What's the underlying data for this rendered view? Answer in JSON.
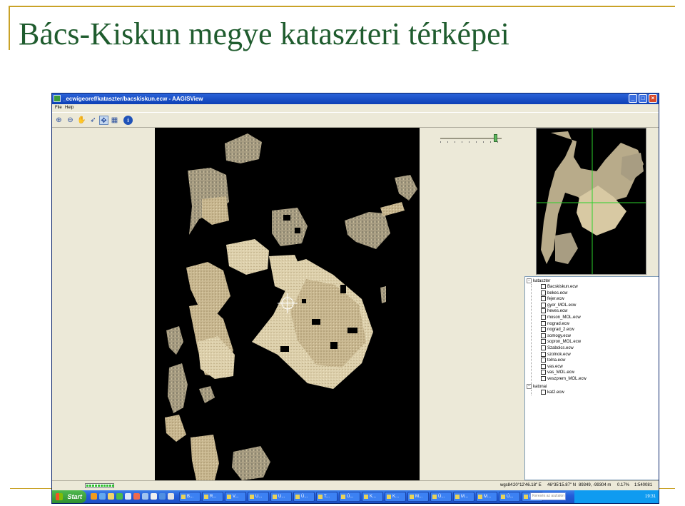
{
  "slide": {
    "title": "Bács-Kiskun megye kataszteri térképei"
  },
  "window": {
    "title": "_ecwigeoref/kataszter/bacskiskun.ecw - AAGISView",
    "menu": [
      "File",
      "Help"
    ],
    "toolbar": {
      "tools": [
        "zoom-in",
        "zoom-out",
        "pan",
        "select",
        "zoom-extent",
        "layers",
        "info"
      ],
      "active_tool": "zoom-extent"
    },
    "zoom_level_fraction": 0.92
  },
  "tree": {
    "groups": [
      {
        "name": "kataszter",
        "items": [
          "Bacskiskun.ecw",
          "bekes.ecw",
          "fejer.ecw",
          "gyor_MOL.ecw",
          "heves.ecw",
          "moson_MOL.ecw",
          "nograd.ecw",
          "nograd_2.ecw",
          "somogy.ecw",
          "sopron_MOL.ecw",
          "Szabolcs.ecw",
          "szolnok.ecw",
          "tolna.ecw",
          "vas.ecw",
          "vas_MOL.ecw",
          "veszprem_MOL.ecw"
        ]
      },
      {
        "name": "katonai",
        "items": [
          "kat2.ecw"
        ]
      }
    ]
  },
  "statusbar": {
    "progress_fraction": 1.0,
    "projection": "wgs84",
    "longitude": "20°12'46.18\" E",
    "latitude": "46°35'15.87\" N",
    "xy": "89349, -99304 m",
    "percent": "0.17%",
    "scale": "1:540081"
  },
  "taskbar": {
    "start_label": "Start",
    "buttons": [
      "B...",
      "R...",
      "V...",
      "U...",
      "U...",
      "Ú...",
      "T...",
      "Ú...",
      "K...",
      "K...",
      "M...",
      "Ú...",
      "M...",
      "M...",
      "Ú...",
      "M..."
    ],
    "search_placeholder": "Keresés az asztalon",
    "clock": "19:31"
  }
}
